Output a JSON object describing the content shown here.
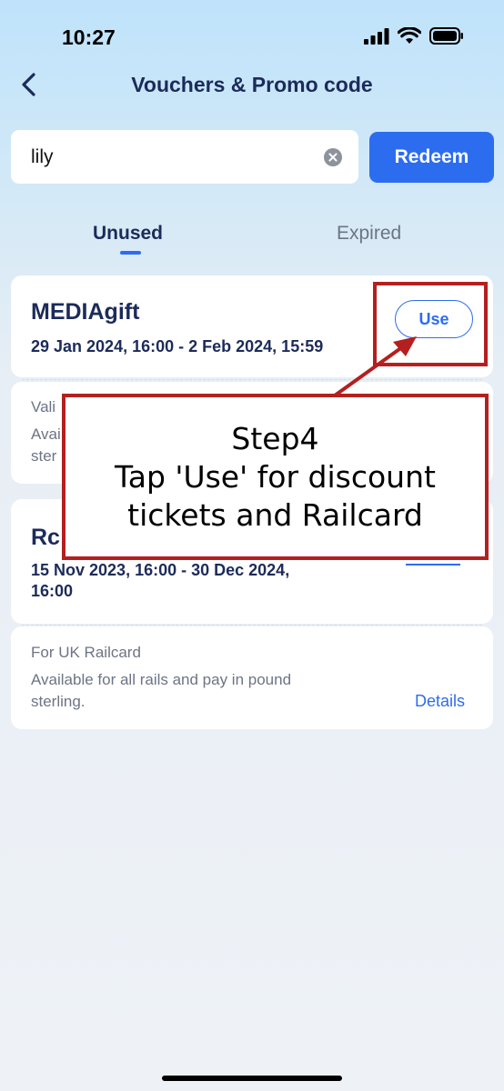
{
  "status_bar": {
    "time": "10:27"
  },
  "header": {
    "title": "Vouchers & Promo code"
  },
  "search": {
    "value": "lily",
    "redeem_label": "Redeem"
  },
  "tabs": [
    {
      "label": "Unused",
      "active": true
    },
    {
      "label": "Expired",
      "active": false
    }
  ],
  "vouchers": [
    {
      "name": "MEDIAgift",
      "validity": "29 Jan 2024, 16:00 - 2 Feb 2024, 15:59",
      "use_label": "Use",
      "label_partial": "Vali",
      "desc_partial_1": "Avai",
      "desc_partial_2": "ster"
    },
    {
      "name_partial": "Rc",
      "validity_line1": "15 Nov 2023, 16:00 - 30 Dec 2024,",
      "validity_line2": "16:00",
      "label": "For UK Railcard",
      "desc_line1": "Available for all rails and pay in pound",
      "desc_line2": "sterling.",
      "details_label": "Details"
    }
  ],
  "annotation": {
    "line1": "Step4",
    "line2": "Tap 'Use' for discount",
    "line3": "tickets and Railcard",
    "color": "#b3201f"
  },
  "colors": {
    "accent": "#2c6df0",
    "heading": "#1c2b5a",
    "muted": "#6d7484"
  }
}
